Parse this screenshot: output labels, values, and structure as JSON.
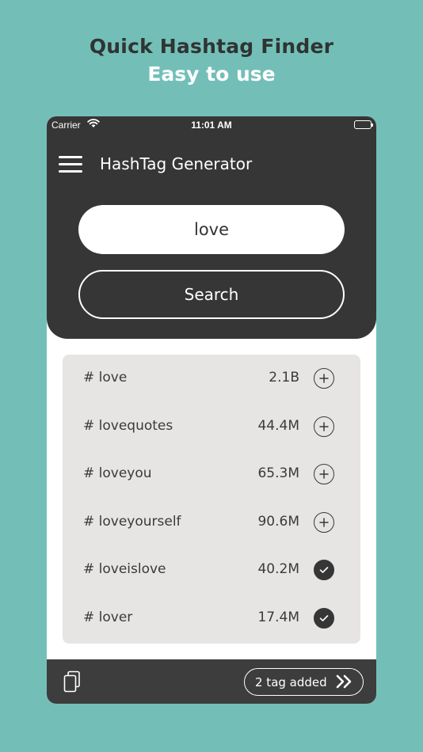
{
  "promo": {
    "title": "Quick Hashtag Finder",
    "subtitle": "Easy to use"
  },
  "status_bar": {
    "carrier": "Carrier",
    "time": "11:01 AM"
  },
  "app": {
    "title": "HashTag Generator"
  },
  "search": {
    "value": "love",
    "button_label": "Search"
  },
  "results": [
    {
      "tag": "# love",
      "count": "2.1B",
      "added": false
    },
    {
      "tag": "# lovequotes",
      "count": "44.4M",
      "added": false
    },
    {
      "tag": "# loveyou",
      "count": "65.3M",
      "added": false
    },
    {
      "tag": "# loveyourself",
      "count": "90.6M",
      "added": false
    },
    {
      "tag": "# loveislove",
      "count": "40.2M",
      "added": true
    },
    {
      "tag": "# lover",
      "count": "17.4M",
      "added": true
    }
  ],
  "bottom_bar": {
    "tag_added_label": "2 tag added"
  },
  "icons": {
    "menu": "hamburger-menu-icon",
    "add": "plus-circle-icon",
    "added": "check-circle-icon",
    "copy": "copy-icon",
    "next": "double-chevron-right-icon"
  },
  "colors": {
    "background": "#73bfb8",
    "panel": "#363636",
    "results_bg": "#e6e5e3",
    "accent_text": "#ffffff"
  }
}
